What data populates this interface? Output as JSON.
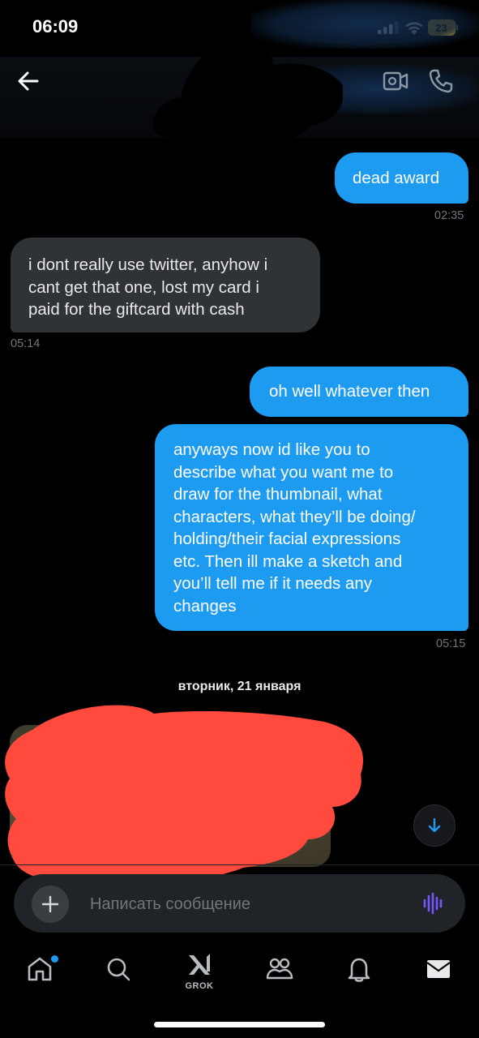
{
  "status_bar": {
    "time": "06:09",
    "battery_level": "23"
  },
  "header": {
    "back_icon": "arrow-left-icon",
    "video_icon": "video-camera-icon",
    "call_icon": "phone-icon"
  },
  "messages": [
    {
      "direction": "out",
      "text": "dead award",
      "time": "02:35"
    },
    {
      "direction": "in",
      "text": "i dont really use twitter, anyhow i\ncant get that one, lost my card i\npaid for the giftcard with cash",
      "time": "05:14"
    },
    {
      "direction": "out",
      "text": "oh well whatever then",
      "time": ""
    },
    {
      "direction": "out",
      "text": "anyways now id like you to\ndescribe what you want me to\ndraw for the thumbnail, what\ncharacters, what they’ll be doing/\nholding/their facial expressions\netc. Then ill make a sketch and\nyou’ll tell me if it needs any\nchanges",
      "time": "05:15"
    }
  ],
  "date_separator": "вторник, 21 января",
  "composer": {
    "placeholder": "Написать сообщение",
    "value": ""
  },
  "tabs": [
    {
      "name": "home",
      "icon": "home-icon",
      "has_badge": true
    },
    {
      "name": "search",
      "icon": "search-icon"
    },
    {
      "name": "grok",
      "icon": "grok-icon",
      "label": "GROK"
    },
    {
      "name": "communities",
      "icon": "people-icon"
    },
    {
      "name": "notifications",
      "icon": "bell-icon"
    },
    {
      "name": "messages",
      "icon": "envelope-icon"
    }
  ],
  "colors": {
    "accent": "#1d9bf0",
    "incoming_bubble": "#2f3336",
    "background": "#000000",
    "redaction": "#ff4a3d",
    "voice_icon": "#7856ff"
  }
}
